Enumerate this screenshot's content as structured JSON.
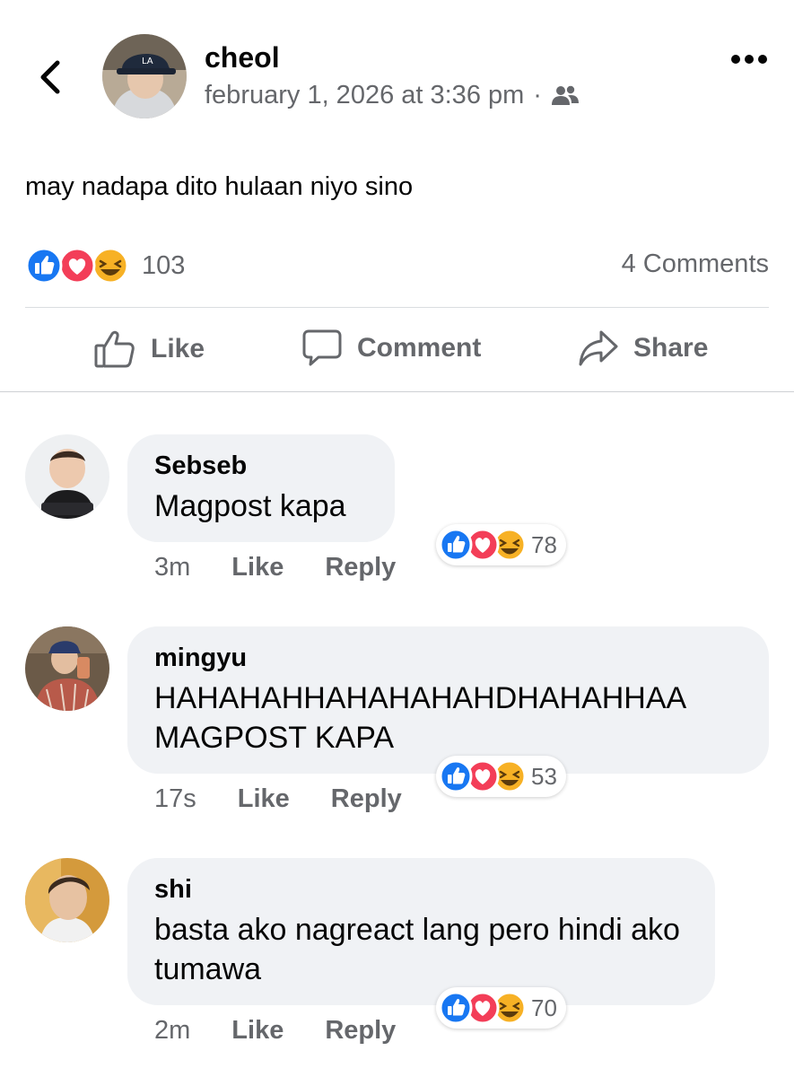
{
  "post": {
    "author": "cheol",
    "timestamp": "february 1, 2026 at 3:36 pm",
    "separator": "·",
    "audience_icon": "friends-icon",
    "text": "may nadapa dito hulaan niyo sino",
    "reaction_count": "103",
    "comments_label": "4 Comments"
  },
  "actions": {
    "like": "Like",
    "comment": "Comment",
    "share": "Share"
  },
  "comments": [
    {
      "name": "Sebseb",
      "text": "Magpost kapa",
      "time": "3m",
      "like": "Like",
      "reply": "Reply",
      "reactions": "78"
    },
    {
      "name": "mingyu",
      "text": "HAHAHAHHAHAHAHAHDHAHAHHAA MAGPOST KAPA",
      "time": "17s",
      "like": "Like",
      "reply": "Reply",
      "reactions": "53"
    },
    {
      "name": "shi",
      "text": "basta ako nagreact lang pero hindi ako tumawa",
      "time": "2m",
      "like": "Like",
      "reply": "Reply",
      "reactions": "70"
    }
  ],
  "colors": {
    "like_blue": "#1877f2",
    "love_red": "#f33e58",
    "haha_yellow": "#f7b125",
    "secondary_text": "#65676b",
    "bubble_bg": "#f0f2f5"
  }
}
